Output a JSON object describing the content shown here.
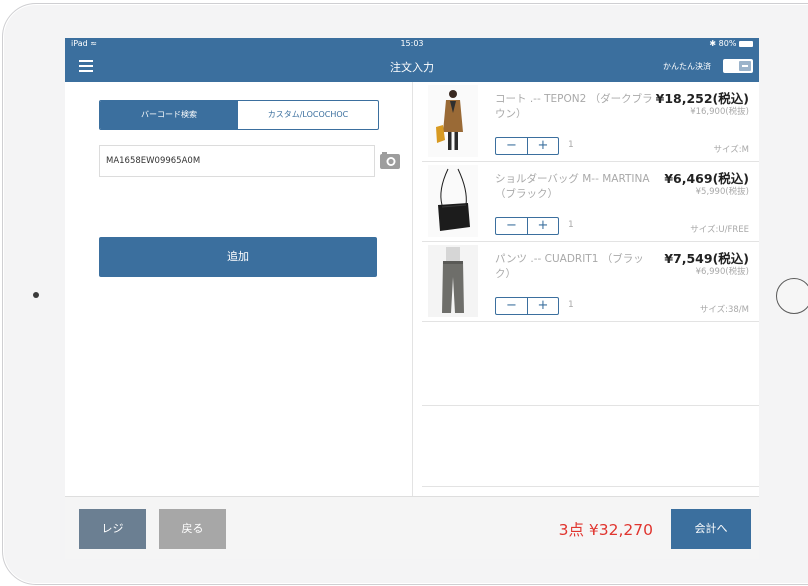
{
  "status_bar": {
    "device": "iPad",
    "time": "15:03",
    "battery": "80%"
  },
  "navbar": {
    "title": "注文入力",
    "easy_pay_label": "かんたん決済"
  },
  "search": {
    "tabs": [
      {
        "label": "バーコード検索",
        "active": true
      },
      {
        "label": "カスタム/LOCOCHOC",
        "active": false
      }
    ],
    "barcode_value": "MA1658EW09965A0M",
    "add_button": "追加"
  },
  "cart": {
    "items": [
      {
        "name": "コート .-- TEPON2 （ダークブラウン）",
        "price_tax": "¥18,252(税込)",
        "price_ex": "¥16,900(税抜)",
        "quantity": "1",
        "size": "サイズ:M",
        "image": "coat-photo"
      },
      {
        "name": "ショルダーバッグ M-- MARTINA （ブラック）",
        "price_tax": "¥6,469(税込)",
        "price_ex": "¥5,990(税抜)",
        "quantity": "1",
        "size": "サイズ:U/FREE",
        "image": "bag-photo"
      },
      {
        "name": "パンツ .-- CUADRIT1 （ブラック）",
        "price_tax": "¥7,549(税込)",
        "price_ex": "¥6,990(税抜)",
        "quantity": "1",
        "size": "サイズ:38/M",
        "image": "pants-photo"
      }
    ]
  },
  "footer": {
    "register_button": "レジ",
    "back_button": "戻る",
    "total": "3点 ¥32,270",
    "checkout_button": "会計へ"
  },
  "colors": {
    "accent": "#3b6f9e",
    "total_red": "#e0352f",
    "register_gray": "#6b7f92",
    "back_gray": "#a7a7a7"
  }
}
